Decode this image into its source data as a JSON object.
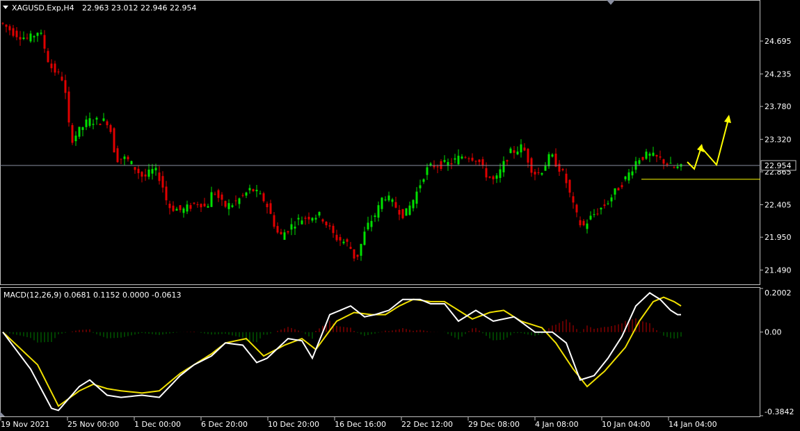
{
  "header": {
    "symbol": "XAGUSD.Exp,H4",
    "ohlc": "22.963 23.012 22.946 22.954"
  },
  "macd_header": {
    "label": "MACD(12,26,9) 0.0681 0.1152 0.0000 -0.0613"
  },
  "colors": {
    "background": "#000000",
    "bull": "#00e000",
    "bear": "#e00000",
    "frame": "#c0c0c0",
    "price_line": "#8a8fa0",
    "macd_line": "#ffffff",
    "signal_line": "#f0e000",
    "arrow": "#ffff00",
    "support": "#ffff00"
  },
  "chart_data": [
    {
      "type": "candlestick",
      "ylim": [
        21.3,
        25.25
      ],
      "y_ticks": [
        "24.695",
        "24.235",
        "23.780",
        "23.320",
        "22.865",
        "22.405",
        "21.950",
        "21.490"
      ],
      "current_price": "22.954",
      "x_labels": [
        "19 Nov 2021",
        "25 Nov 00:00",
        "1 Dec 00:00",
        "6 Dec 20:00",
        "10 Dec 20:00",
        "16 Dec 16:00",
        "22 Dec 12:00",
        "29 Dec 08:00",
        "4 Jan 08:00",
        "10 Jan 04:00",
        "14 Jan 04:00"
      ],
      "close_path": [
        [
          0,
          24.95
        ],
        [
          4,
          24.8
        ],
        [
          8,
          24.72
        ],
        [
          11,
          24.85
        ],
        [
          14,
          24.35
        ],
        [
          18,
          24.15
        ],
        [
          20,
          23.3
        ],
        [
          25,
          23.58
        ],
        [
          31,
          23.57
        ],
        [
          33,
          23.05
        ],
        [
          36,
          23.05
        ],
        [
          41,
          22.78
        ],
        [
          44,
          22.9
        ],
        [
          46,
          22.75
        ],
        [
          48,
          22.38
        ],
        [
          52,
          22.32
        ],
        [
          57,
          22.45
        ],
        [
          59,
          22.35
        ],
        [
          61,
          22.62
        ],
        [
          64,
          22.38
        ],
        [
          67,
          22.42
        ],
        [
          72,
          22.63
        ],
        [
          76,
          22.45
        ],
        [
          80,
          21.95
        ],
        [
          85,
          22.18
        ],
        [
          89,
          22.25
        ],
        [
          92,
          22.25
        ],
        [
          96,
          21.95
        ],
        [
          100,
          21.85
        ],
        [
          102,
          21.62
        ],
        [
          105,
          22.08
        ],
        [
          108,
          22.3
        ],
        [
          110,
          22.55
        ],
        [
          114,
          22.35
        ],
        [
          116,
          22.25
        ],
        [
          119,
          22.52
        ],
        [
          122,
          22.88
        ],
        [
          124,
          22.95
        ],
        [
          129,
          22.98
        ],
        [
          133,
          23.1
        ],
        [
          137,
          23.05
        ],
        [
          139,
          22.85
        ],
        [
          142,
          22.72
        ],
        [
          146,
          23.12
        ],
        [
          150,
          23.22
        ],
        [
          153,
          22.85
        ],
        [
          155,
          22.85
        ],
        [
          158,
          23.1
        ],
        [
          162,
          22.8
        ],
        [
          165,
          22.3
        ],
        [
          167,
          22.08
        ],
        [
          170,
          22.25
        ],
        [
          174,
          22.42
        ],
        [
          176,
          22.55
        ],
        [
          180,
          22.8
        ],
        [
          183,
          23.05
        ],
        [
          186,
          23.1
        ],
        [
          189,
          23.05
        ],
        [
          191,
          23.0
        ],
        [
          193,
          22.92
        ],
        [
          195,
          22.92
        ]
      ],
      "macd_ylim": [
        -0.3842,
        0.2002
      ],
      "macd_ticks": [
        "0.2002",
        "0.00",
        "-0.3842"
      ],
      "macd": [
        [
          0,
          0.0
        ],
        [
          8,
          -0.17
        ],
        [
          14,
          -0.35
        ],
        [
          16,
          -0.36
        ],
        [
          22,
          -0.25
        ],
        [
          25,
          -0.22
        ],
        [
          30,
          -0.29
        ],
        [
          34,
          -0.3
        ],
        [
          40,
          -0.29
        ],
        [
          45,
          -0.3
        ],
        [
          51,
          -0.2
        ],
        [
          55,
          -0.15
        ],
        [
          60,
          -0.11
        ],
        [
          64,
          -0.05
        ],
        [
          69,
          -0.06
        ],
        [
          73,
          -0.14
        ],
        [
          76,
          -0.12
        ],
        [
          82,
          -0.03
        ],
        [
          86,
          -0.04
        ],
        [
          89,
          -0.12
        ],
        [
          94,
          0.08
        ],
        [
          100,
          0.12
        ],
        [
          104,
          0.07
        ],
        [
          107,
          0.08
        ],
        [
          111,
          0.1
        ],
        [
          115,
          0.15
        ],
        [
          120,
          0.15
        ],
        [
          123,
          0.13
        ],
        [
          127,
          0.13
        ],
        [
          131,
          0.05
        ],
        [
          136,
          0.1
        ],
        [
          141,
          0.05
        ],
        [
          147,
          0.07
        ],
        [
          153,
          0.0
        ],
        [
          158,
          0.0
        ],
        [
          162,
          -0.05
        ],
        [
          166,
          -0.22
        ],
        [
          170,
          -0.2
        ],
        [
          174,
          -0.12
        ],
        [
          178,
          -0.02
        ],
        [
          182,
          0.12
        ],
        [
          186,
          0.18
        ],
        [
          189,
          0.15
        ],
        [
          192,
          0.1
        ],
        [
          194,
          0.08
        ]
      ],
      "signal": [
        [
          0,
          0.0
        ],
        [
          10,
          -0.15
        ],
        [
          16,
          -0.34
        ],
        [
          22,
          -0.27
        ],
        [
          26,
          -0.24
        ],
        [
          30,
          -0.26
        ],
        [
          34,
          -0.27
        ],
        [
          40,
          -0.28
        ],
        [
          45,
          -0.27
        ],
        [
          51,
          -0.19
        ],
        [
          56,
          -0.14
        ],
        [
          60,
          -0.1
        ],
        [
          64,
          -0.05
        ],
        [
          70,
          -0.03
        ],
        [
          75,
          -0.11
        ],
        [
          81,
          -0.06
        ],
        [
          86,
          -0.03
        ],
        [
          90,
          -0.08
        ],
        [
          96,
          0.05
        ],
        [
          101,
          0.09
        ],
        [
          106,
          0.08
        ],
        [
          110,
          0.08
        ],
        [
          114,
          0.12
        ],
        [
          118,
          0.15
        ],
        [
          123,
          0.14
        ],
        [
          127,
          0.14
        ],
        [
          131,
          0.1
        ],
        [
          135,
          0.06
        ],
        [
          140,
          0.09
        ],
        [
          144,
          0.1
        ],
        [
          149,
          0.05
        ],
        [
          155,
          0.02
        ],
        [
          159,
          -0.05
        ],
        [
          164,
          -0.17
        ],
        [
          168,
          -0.25
        ],
        [
          173,
          -0.18
        ],
        [
          179,
          -0.07
        ],
        [
          183,
          0.05
        ],
        [
          187,
          0.14
        ],
        [
          190,
          0.16
        ],
        [
          193,
          0.14
        ],
        [
          195,
          0.12
        ]
      ]
    }
  ]
}
